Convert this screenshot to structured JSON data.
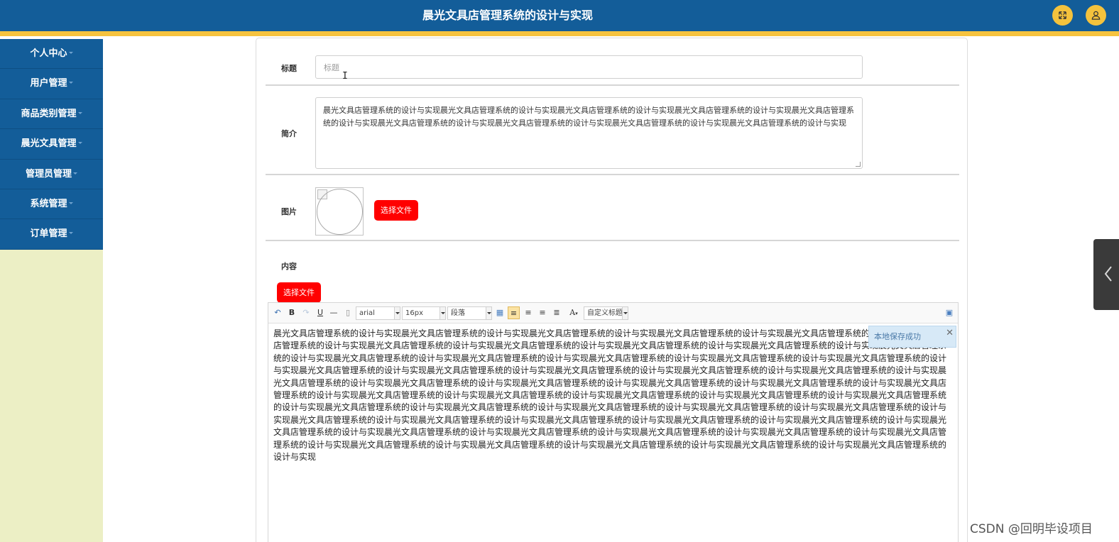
{
  "header": {
    "title": "晨光文具店管理系统的设计与实现",
    "fullscreen_icon": "expand-arrows-icon",
    "user_icon": "user-icon"
  },
  "sidebar": {
    "items": [
      {
        "label": "个人中心"
      },
      {
        "label": "用户管理"
      },
      {
        "label": "商品类别管理"
      },
      {
        "label": "晨光文具管理"
      },
      {
        "label": "管理员管理"
      },
      {
        "label": "系统管理"
      },
      {
        "label": "订单管理"
      }
    ]
  },
  "form": {
    "title_label": "标题",
    "title_placeholder": "标题",
    "intro_label": "简介",
    "intro_value": "晨光文具店管理系统的设计与实现晨光文具店管理系统的设计与实现晨光文具店管理系统的设计与实现晨光文具店管理系统的设计与实现晨光文具店管理系统的设计与实现晨光文具店管理系统的设计与实现晨光文具店管理系统的设计与实现晨光文具店管理系统的设计与实现晨光文具店管理系统的设计与实现",
    "image_label": "图片",
    "image_choose_button": "选择文件",
    "content_label": "内容",
    "content_choose_button": "选择文件"
  },
  "editor": {
    "toolbar": {
      "bold": "B",
      "underline": "U",
      "font_family": "arial",
      "font_size": "16px",
      "paragraph": "段落",
      "font_color": "A",
      "custom_title": "自定义标题"
    },
    "content": "晨光文具店管理系统的设计与实现晨光文具店管理系统的设计与实现晨光文具店管理系统的设计与实现晨光文具店管理系统的设计与实现晨光文具店管理系统的设计与实现晨光文具店管理系统的设计与实现晨光文具店管理系统的设计与实现晨光文具店管理系统的设计与实现晨光文具店管理系统的设计与实现晨光文具店管理系统的设计与实现晨光文具店管理系统的设计与实现晨光文具店管理系统的设计与实现晨光文具店管理系统的设计与实现晨光文具店管理系统的设计与实现晨光文具店管理系统的设计与实现晨光文具店管理系统的设计与实现晨光文具店管理系统的设计与实现晨光文具店管理系统的设计与实现晨光文具店管理系统的设计与实现晨光文具店管理系统的设计与实现晨光文具店管理系统的设计与实现晨光文具店管理系统的设计与实现晨光文具店管理系统的设计与实现晨光文具店管理系统的设计与实现晨光文具店管理系统的设计与实现晨光文具店管理系统的设计与实现晨光文具店管理系统的设计与实现晨光文具店管理系统的设计与实现晨光文具店管理系统的设计与实现晨光文具店管理系统的设计与实现晨光文具店管理系统的设计与实现晨光文具店管理系统的设计与实现晨光文具店管理系统的设计与实现晨光文具店管理系统的设计与实现晨光文具店管理系统的设计与实现晨光文具店管理系统的设计与实现晨光文具店管理系统的设计与实现晨光文具店管理系统的设计与实现晨光文具店管理系统的设计与实现晨光文具店管理系统的设计与实现晨光文具店管理系统的设计与实现晨光文具店管理系统的设计与实现晨光文具店管理系统的设计与实现晨光文具店管理系统的设计与实现晨光文具店管理系统的设计与实现晨光文具店管理系统的设计与实现晨光文具店管理系统的设计与实现晨光文具店管理系统的设计与实现晨光文具店管理系统的设计与实现晨光文具店管理系统的设计与实现晨光文具店管理系统的设计与实现晨光文具店管理系统的设计与实现晨光文具店管理系统的设计与实现",
    "toast": "本地保存成功",
    "toast_close": "✕"
  },
  "watermark": "CSDN @回明毕设项目",
  "colors": {
    "header_bg": "#135d99",
    "header_stripe": "#f6c33e",
    "sidebar_bg": "#ecefc5",
    "button_red": "#ff0000"
  }
}
